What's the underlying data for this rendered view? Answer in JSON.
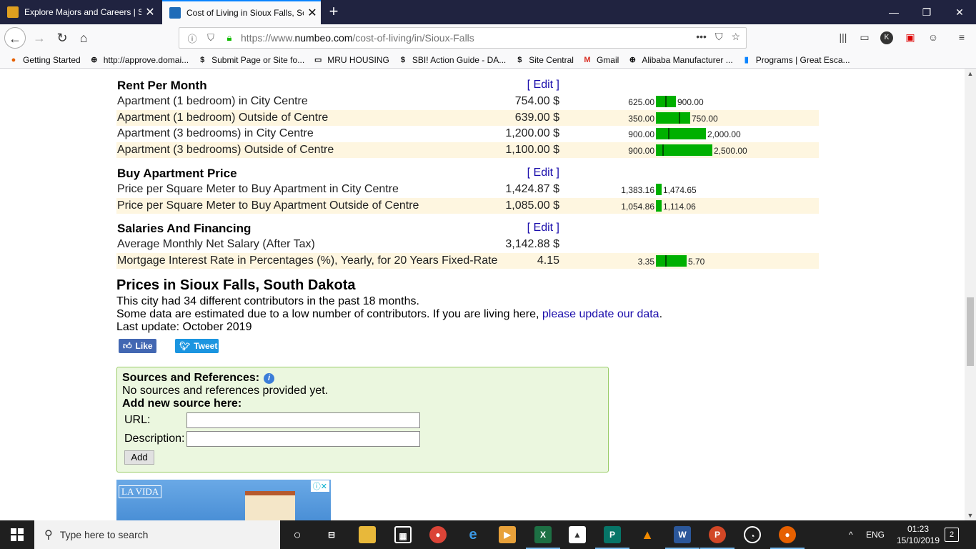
{
  "browser": {
    "tabs": [
      {
        "label": "Explore Majors and Careers | So",
        "active": false
      },
      {
        "label": "Cost of Living in Sioux Falls, So",
        "active": true
      }
    ],
    "new_tab": "+",
    "window_controls": {
      "minimize": "—",
      "restore": "❐",
      "close": "✕"
    },
    "url_prefix": "https://www.",
    "url_domain": "numbeo.com",
    "url_path": "/cost-of-living/in/Sioux-Falls",
    "url_more": "•••",
    "bookmarks": [
      {
        "label": "Getting Started",
        "icon": "firefox-icon"
      },
      {
        "label": "http://approve.domai...",
        "icon": "globe-icon"
      },
      {
        "label": "Submit Page or Site fo...",
        "icon": "dollar-icon"
      },
      {
        "label": "MRU HOUSING",
        "icon": "folder-icon"
      },
      {
        "label": "SBI! Action Guide - DA...",
        "icon": "dollar-icon"
      },
      {
        "label": "Site Central",
        "icon": "dollar-icon"
      },
      {
        "label": "Gmail",
        "icon": "gmail-icon"
      },
      {
        "label": "Alibaba Manufacturer ...",
        "icon": "globe-icon"
      },
      {
        "label": "Programs | Great Esca...",
        "icon": "bookmark-icon"
      }
    ]
  },
  "sections": {
    "rent": {
      "title": "Rent Per Month",
      "edit": "[ Edit ]",
      "rows": [
        {
          "name": "Apartment (1 bedroom) in City Centre",
          "price": "754.00 $",
          "low": "625.00",
          "high": "900.00"
        },
        {
          "name": "Apartment (1 bedroom) Outside of Centre",
          "price": "639.00 $",
          "low": "350.00",
          "high": "750.00"
        },
        {
          "name": "Apartment (3 bedrooms) in City Centre",
          "price": "1,200.00 $",
          "low": "900.00",
          "high": "2,000.00"
        },
        {
          "name": "Apartment (3 bedrooms) Outside of Centre",
          "price": "1,100.00 $",
          "low": "900.00",
          "high": "2,500.00"
        }
      ]
    },
    "buy": {
      "title": "Buy Apartment Price",
      "edit": "[ Edit ]",
      "rows": [
        {
          "name": "Price per Square Meter to Buy Apartment in City Centre",
          "price": "1,424.87 $",
          "low": "1,383.16",
          "high": "1,474.65"
        },
        {
          "name": "Price per Square Meter to Buy Apartment Outside of Centre",
          "price": "1,085.00 $",
          "low": "1,054.86",
          "high": "1,114.06"
        }
      ]
    },
    "salaries": {
      "title": "Salaries And Financing",
      "edit": "[ Edit ]",
      "rows": [
        {
          "name": "Average Monthly Net Salary (After Tax)",
          "price": "3,142.88 $"
        },
        {
          "name": "Mortgage Interest Rate in Percentages (%), Yearly, for 20 Years Fixed-Rate",
          "price": "4.15",
          "low": "3.35",
          "high": "5.70"
        }
      ]
    }
  },
  "prices": {
    "title": "Prices in Sioux Falls, South Dakota",
    "contributors": "This city had 34 different contributors in the past 18 months.",
    "estimated": "Some data are estimated due to a low number of contributors. If you are living here,",
    "update_link": "please update our data",
    "period": ".",
    "last_update": "Last update: October 2019"
  },
  "social": {
    "like": "Like",
    "tweet": "Tweet"
  },
  "sources": {
    "title": "Sources and References:",
    "none": "No sources and references provided yet.",
    "add_title": "Add new source here:",
    "url_label": "URL:",
    "desc_label": "Description:",
    "add_button": "Add"
  },
  "ad": {
    "logo": "LA VIDA"
  },
  "taskbar": {
    "search_placeholder": "Type here to search",
    "language": "ENG",
    "time": "01:23",
    "date": "15/10/2019",
    "notifications": "2",
    "tray_arrow": "^"
  }
}
